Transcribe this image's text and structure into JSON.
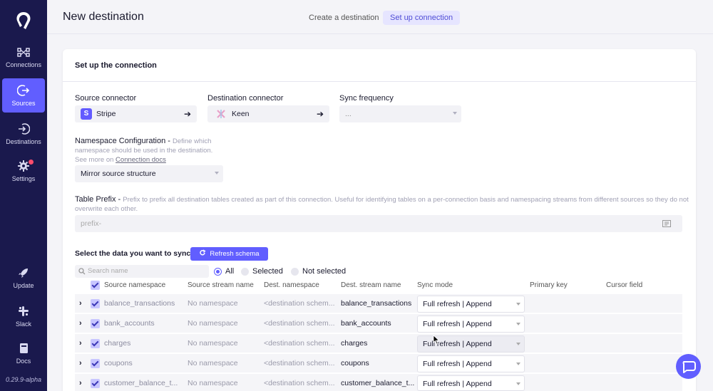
{
  "sidebar": {
    "items": [
      {
        "label": "Connections"
      },
      {
        "label": "Sources"
      },
      {
        "label": "Destinations"
      },
      {
        "label": "Settings"
      },
      {
        "label": "Update"
      },
      {
        "label": "Slack"
      },
      {
        "label": "Docs"
      }
    ],
    "version": "0.29.9-alpha"
  },
  "header": {
    "title": "New destination",
    "steps": [
      "Create a destination",
      "Set up connection"
    ]
  },
  "card": {
    "title": "Set up the connection",
    "source_label": "Source connector",
    "source_value": "Stripe",
    "destination_label": "Destination connector",
    "destination_value": "Keen",
    "frequency_label": "Sync frequency",
    "frequency_value": "...",
    "namespace_label": "Namespace Configuration - ",
    "namespace_help": "Define which namespace should be used in the destination. See more on ",
    "namespace_link": "Connection docs",
    "namespace_value": "Mirror source structure",
    "prefix_label": "Table Prefix - ",
    "prefix_help": "Prefix to prefix all destination tables created as part of this connection. Useful for identifying tables on a per-connection basis and namespacing streams from different sources so they do not overwrite each other.",
    "prefix_placeholder": "prefix-",
    "select_data_label": "Select the data you want to sync",
    "refresh_label": "Refresh schema",
    "search_placeholder": "Search name",
    "filters": [
      "All",
      "Selected",
      "Not selected"
    ]
  },
  "table": {
    "headers": [
      "Source namespace",
      "Source stream name",
      "Dest. namespace",
      "Dest. stream name",
      "Sync mode",
      "Primary key",
      "Cursor field"
    ],
    "rows": [
      {
        "source": "balance_transactions",
        "src_ns": "No namespace",
        "dest_ns": "<destination schem...",
        "dest": "balance_transactions",
        "sync": "Full refresh",
        "sync2": "Append"
      },
      {
        "source": "bank_accounts",
        "src_ns": "No namespace",
        "dest_ns": "<destination schem...",
        "dest": "bank_accounts",
        "sync": "Full refresh",
        "sync2": "Append"
      },
      {
        "source": "charges",
        "src_ns": "No namespace",
        "dest_ns": "<destination schem...",
        "dest": "charges",
        "sync": "Full refresh",
        "sync2": "Append"
      },
      {
        "source": "coupons",
        "src_ns": "No namespace",
        "dest_ns": "<destination schem...",
        "dest": "coupons",
        "sync": "Full refresh",
        "sync2": "Append"
      },
      {
        "source": "customer_balance_t...",
        "src_ns": "No namespace",
        "dest_ns": "<destination schem...",
        "dest": "customer_balance_t...",
        "sync": "Full refresh",
        "sync2": "Append"
      }
    ]
  },
  "colors": {
    "accent": "#615eff",
    "sidebar": "#1a194d"
  }
}
